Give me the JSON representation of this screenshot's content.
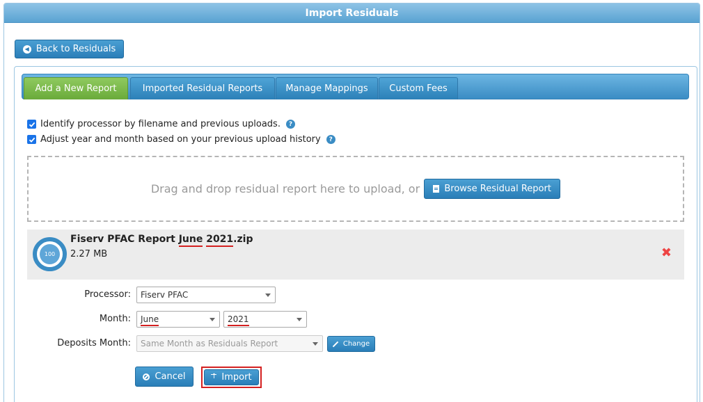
{
  "window": {
    "title": "Import Residuals"
  },
  "back_button": {
    "label": "Back to Residuals"
  },
  "tabs": [
    {
      "label": "Add a New Report",
      "active": true
    },
    {
      "label": "Imported Residual Reports",
      "active": false
    },
    {
      "label": "Manage Mappings",
      "active": false
    },
    {
      "label": "Custom Fees",
      "active": false
    }
  ],
  "options": {
    "identify_processor": {
      "label": "Identify processor by filename and previous uploads.",
      "checked": true
    },
    "adjust_year_month": {
      "label": "Adjust year and month based on your previous upload history",
      "checked": true
    },
    "help_glyph": "?"
  },
  "dropzone": {
    "text": "Drag and drop residual report here to upload, or",
    "browse_label": "Browse Residual Report"
  },
  "file": {
    "name_prefix": "Fiserv PFAC Report ",
    "name_month": "June",
    "name_space": " ",
    "name_year": "2021",
    "name_ext": ".zip",
    "size": "2.27 MB",
    "progress": "100",
    "remove_glyph": "✖"
  },
  "form": {
    "processor_label": "Processor:",
    "processor_value": "Fiserv PFAC",
    "month_label": "Month:",
    "month_value": "June",
    "year_value": "2021",
    "deposits_label": "Deposits Month:",
    "deposits_value": "Same Month as Residuals Report",
    "change_label": "Change"
  },
  "actions": {
    "cancel_label": "Cancel",
    "import_label": "Import"
  },
  "colors": {
    "accent": "#2a7eb8",
    "active_tab": "#6aaa3a",
    "highlight": "#d42020"
  }
}
